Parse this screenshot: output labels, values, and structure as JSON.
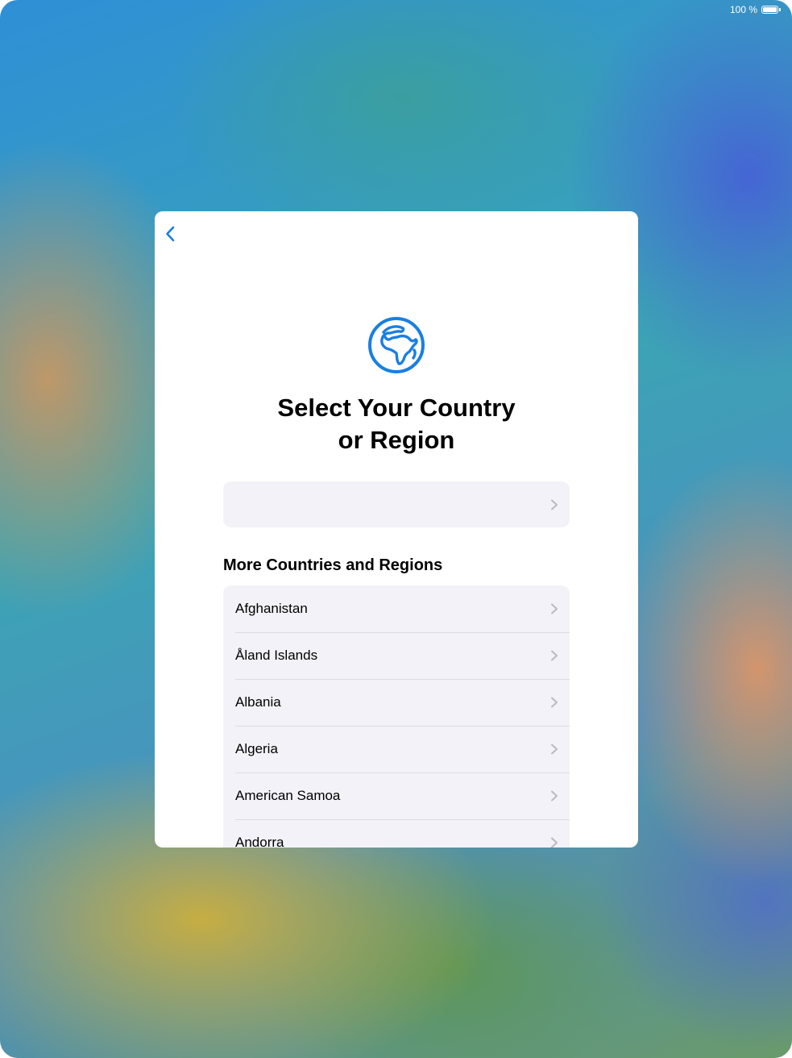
{
  "status_bar": {
    "battery_text": "100 %",
    "battery_icon": "battery-icon"
  },
  "sheet": {
    "back_icon": "chevron-left-icon",
    "globe_icon": "globe-africa-icon",
    "title_line1": "Select Your Country",
    "title_line2": "or Region",
    "current_selection": "",
    "section_header": "More Countries and Regions",
    "countries": [
      "Afghanistan",
      "Åland Islands",
      "Albania",
      "Algeria",
      "American Samoa",
      "Andorra"
    ]
  },
  "colors": {
    "accent": "#1a7fe0",
    "row_background": "#f3f2f8",
    "chevron": "#b9b9bf"
  }
}
